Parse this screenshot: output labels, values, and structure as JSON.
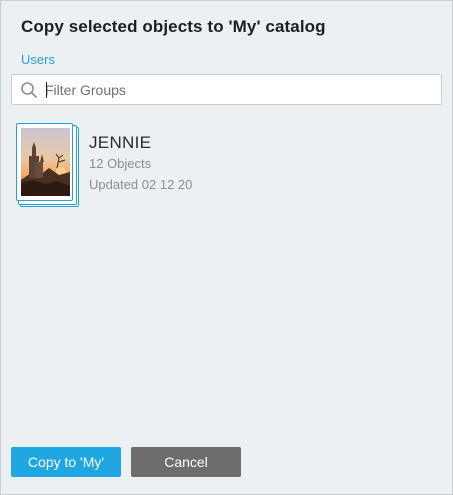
{
  "dialog": {
    "title": "Copy selected objects to 'My' catalog",
    "breadcrumb": "Users"
  },
  "search": {
    "placeholder": "Filter Groups",
    "value": "",
    "icon": "search-icon"
  },
  "groups": [
    {
      "name": "JENNIE",
      "count": "12 Objects",
      "updated": "Updated 02 12 20",
      "thumbnail_icon": "castle-sunset-image"
    }
  ],
  "buttons": {
    "copy_label": "Copy to 'My'",
    "cancel_label": "Cancel"
  },
  "colors": {
    "accent": "#1ea7e1",
    "link": "#2a9fd6",
    "cancel": "#6d6d6d",
    "background": "#edf0f3"
  }
}
